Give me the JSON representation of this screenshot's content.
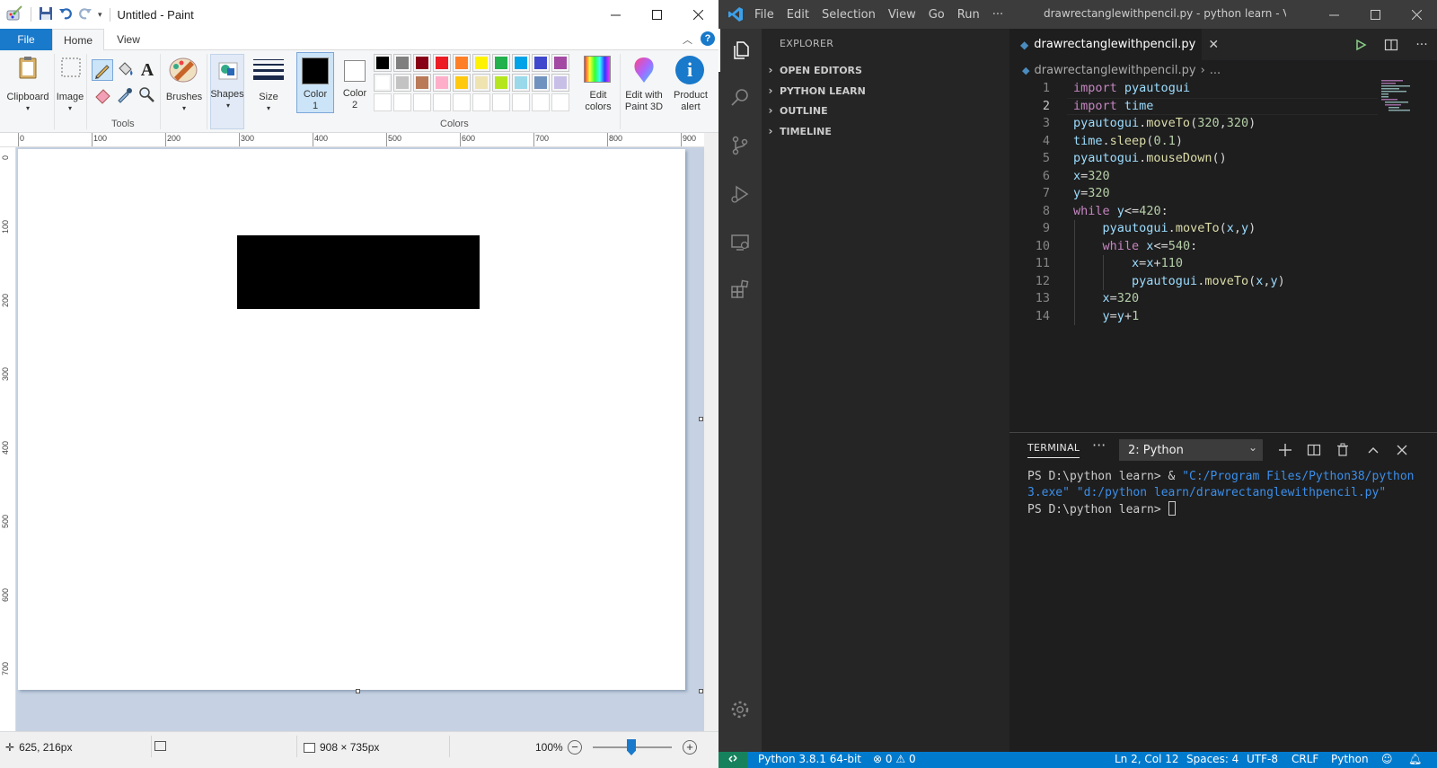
{
  "paint": {
    "title": "Untitled - Paint",
    "tabs": [
      "File",
      "Home",
      "View"
    ],
    "groups": {
      "clipboard": "Clipboard",
      "image": "Image",
      "tools": "Tools",
      "brushes": "Brushes",
      "shapes": "Shapes",
      "size": "Size",
      "color1": "Color\n1",
      "color2": "Color\n2",
      "colors": "Colors",
      "edit_colors": "Edit\ncolors",
      "edit_paint3d": "Edit with\nPaint 3D",
      "product_alert": "Product\nalert"
    },
    "palette_row1": [
      "#000000",
      "#7f7f7f",
      "#880015",
      "#ed1c24",
      "#ff7f27",
      "#fff200",
      "#22b14c",
      "#00a2e8",
      "#3f48cc",
      "#a349a4"
    ],
    "palette_row2": [
      "#ffffff",
      "#c3c3c3",
      "#b97a57",
      "#ffaec9",
      "#ffc90e",
      "#efe4b0",
      "#b5e61d",
      "#99d9ea",
      "#7092be",
      "#c8bfe7"
    ],
    "ruler_h": [
      "0",
      "100",
      "200",
      "300",
      "400",
      "500",
      "600",
      "700",
      "800",
      "900"
    ],
    "ruler_v": [
      "0",
      "100",
      "200",
      "300",
      "400",
      "500",
      "600",
      "700"
    ],
    "status": {
      "cursor_pos": "625, 216px",
      "size": "908 × 735px",
      "zoom": "100%"
    }
  },
  "vscode": {
    "menu": [
      "File",
      "Edit",
      "Selection",
      "View",
      "Go",
      "Run",
      "···"
    ],
    "title": "drawrectanglewithpencil.py - python learn - Visu...",
    "explorer_header": "EXPLORER",
    "sections": [
      "OPEN EDITORS",
      "PYTHON LEARN",
      "OUTLINE",
      "TIMELINE"
    ],
    "tab_name": "drawrectanglewithpencil.py",
    "breadcrumb_file": "drawrectanglewithpencil.py",
    "breadcrumb_more": "...",
    "code_lines": [
      "import pyautogui",
      "import time",
      "pyautogui.moveTo(320,320)",
      "time.sleep(0.1)",
      "pyautogui.mouseDown()",
      "x=320",
      "y=320",
      "while y<=420:",
      "    pyautogui.moveTo(x,y)",
      "    while x<=540:",
      "        x=x+110",
      "        pyautogui.moveTo(x,y)",
      "    x=320",
      "    y=y+1"
    ],
    "panel": {
      "tab": "TERMINAL",
      "more": "···",
      "select": "2: Python",
      "line1_prompt": "PS D:\\python learn> & ",
      "line1_str": "\"C:/Program Files/Python38/python3.exe\" \"d:/python learn/drawrectanglewithpencil.py\"",
      "line2_prompt": "PS D:\\python learn> "
    },
    "status": {
      "python": "Python 3.8.1 64-bit",
      "errors": "0",
      "warnings": "0",
      "position": "Ln 2, Col 12",
      "spaces": "Spaces: 4",
      "encoding": "UTF-8",
      "eol": "CRLF",
      "language": "Python"
    }
  }
}
